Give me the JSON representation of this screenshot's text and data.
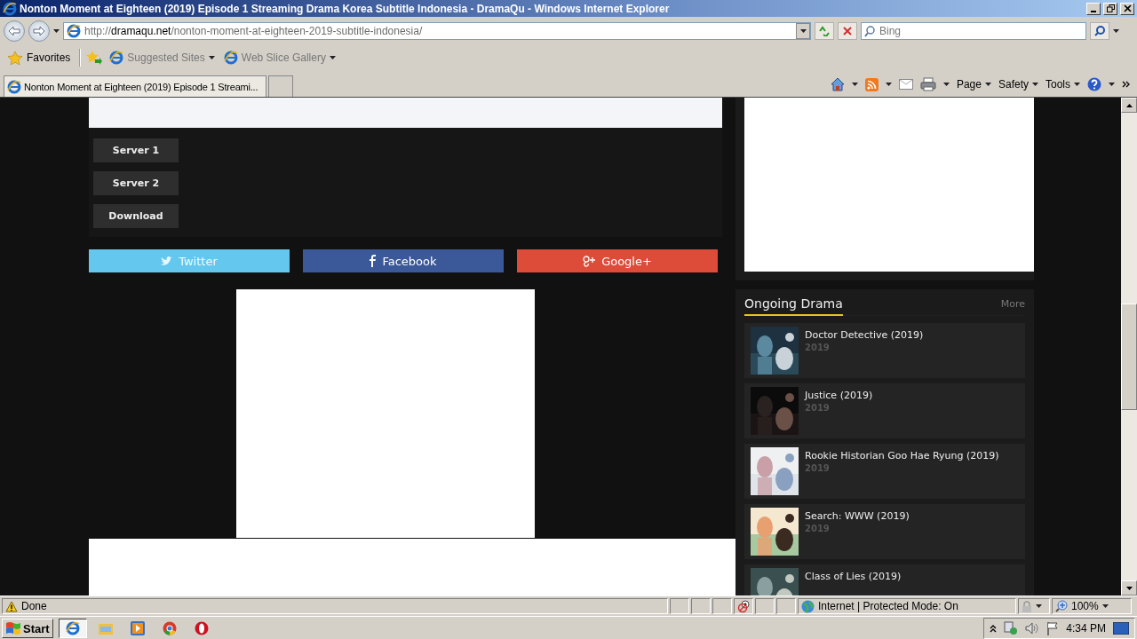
{
  "browser": {
    "title": "Nonton Moment at Eighteen (2019) Episode 1 Streaming Drama Korea Subtitle Indonesia - DramaQu - Windows Internet Explorer",
    "address": "http://**dramaqu.net**/nonton-moment-at-eighteen-2019-subtitle-indonesia/",
    "search": {
      "placeholder": "Bing"
    },
    "favorites": {
      "label": "Favorites",
      "links": [
        "Suggested Sites",
        "Web Slice Gallery"
      ]
    },
    "tab": {
      "title": "Nonton Moment at Eighteen (2019) Episode 1 Streami..."
    },
    "commands": [
      "Page",
      "Safety",
      "Tools"
    ]
  },
  "page": {
    "servers": [
      {
        "label": "Server 1"
      },
      {
        "label": "Server 2"
      },
      {
        "label": "Download"
      }
    ],
    "share": [
      {
        "kind": "twitter",
        "label": "Twitter"
      },
      {
        "kind": "facebook",
        "label": "Facebook"
      },
      {
        "kind": "googleplus",
        "label": "Google+"
      }
    ],
    "sidebar": {
      "section_title": "Ongoing Drama",
      "more": "More",
      "items": [
        {
          "title": "Doctor Detective (2019)",
          "year": "2019"
        },
        {
          "title": "Justice (2019)",
          "year": "2019"
        },
        {
          "title": "Rookie Historian Goo Hae Ryung (2019)",
          "year": "2019"
        },
        {
          "title": "Search: WWW (2019)",
          "year": "2019"
        },
        {
          "title": "Class of Lies (2019)"
        }
      ]
    }
  },
  "status_bar": {
    "status": "Done",
    "zone": "Internet | Protected Mode: On",
    "zoom": "100%"
  },
  "taskbar": {
    "start": "Start",
    "clock": "4:34 PM"
  }
}
